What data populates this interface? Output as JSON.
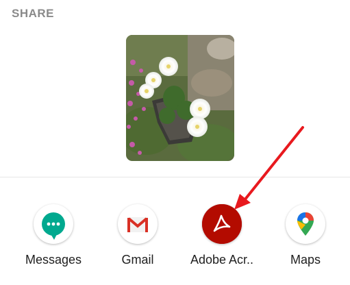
{
  "header": {
    "title": "SHARE"
  },
  "preview": {
    "subject": "flower-photo"
  },
  "apps": [
    {
      "label": "Messages",
      "icon": "messages-icon",
      "color": "#00a98f"
    },
    {
      "label": "Gmail",
      "icon": "gmail-icon",
      "color": "#d93025"
    },
    {
      "label": "Adobe Acr..",
      "icon": "adobe-acrobat-icon",
      "color": "#b30b00"
    },
    {
      "label": "Maps",
      "icon": "maps-icon",
      "color": "#34a853"
    }
  ],
  "annotation": {
    "arrow_color": "#e8191e",
    "target": "Adobe Acr.."
  }
}
